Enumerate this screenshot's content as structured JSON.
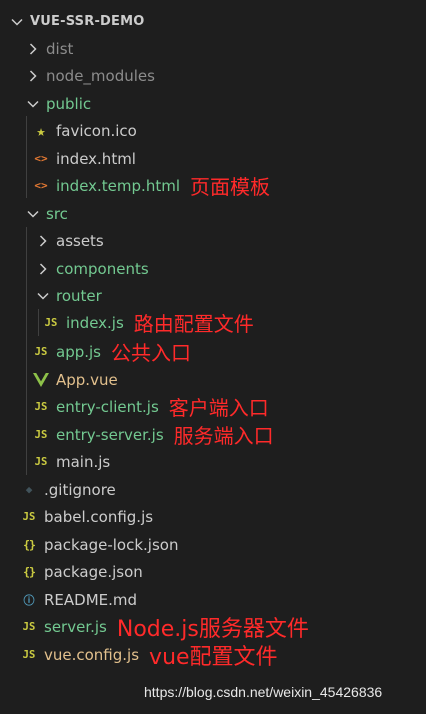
{
  "explorer": {
    "project_title": "VUE-SSR-DEMO",
    "items": [
      {
        "label": "dist",
        "icon": "chevron-right-icon",
        "annotation": ""
      },
      {
        "label": "node_modules",
        "icon": "chevron-right-icon",
        "annotation": ""
      },
      {
        "label": "public",
        "icon": "chevron-down-icon",
        "annotation": ""
      },
      {
        "label": "favicon.ico",
        "icon": "star-icon",
        "annotation": ""
      },
      {
        "label": "index.html",
        "icon": "html-icon",
        "annotation": ""
      },
      {
        "label": "index.temp.html",
        "icon": "html-icon",
        "annotation": "页面模板"
      },
      {
        "label": "src",
        "icon": "chevron-down-icon",
        "annotation": ""
      },
      {
        "label": "assets",
        "icon": "chevron-right-icon",
        "annotation": ""
      },
      {
        "label": "components",
        "icon": "chevron-right-icon",
        "annotation": ""
      },
      {
        "label": "router",
        "icon": "chevron-down-icon",
        "annotation": ""
      },
      {
        "label": "index.js",
        "icon": "js-icon",
        "annotation": "路由配置文件"
      },
      {
        "label": "app.js",
        "icon": "js-icon",
        "annotation": "公共入口"
      },
      {
        "label": "App.vue",
        "icon": "vue-icon",
        "annotation": ""
      },
      {
        "label": "entry-client.js",
        "icon": "js-icon",
        "annotation": "客户端入口"
      },
      {
        "label": "entry-server.js",
        "icon": "js-icon",
        "annotation": "服务端入口"
      },
      {
        "label": "main.js",
        "icon": "js-icon",
        "annotation": ""
      },
      {
        "label": ".gitignore",
        "icon": "git-icon",
        "annotation": ""
      },
      {
        "label": "babel.config.js",
        "icon": "js-icon",
        "annotation": ""
      },
      {
        "label": "package-lock.json",
        "icon": "json-icon",
        "annotation": ""
      },
      {
        "label": "package.json",
        "icon": "json-icon",
        "annotation": ""
      },
      {
        "label": "README.md",
        "icon": "info-icon",
        "annotation": ""
      },
      {
        "label": "server.js",
        "icon": "js-icon",
        "annotation": "Node.js服务器文件"
      },
      {
        "label": "vue.config.js",
        "icon": "js-icon",
        "annotation": "vue配置文件"
      }
    ]
  },
  "icons": {
    "js": "JS",
    "html": "<>",
    "json": "{}",
    "info": "ⓘ",
    "git": "◆",
    "star": "★",
    "vue": "V"
  },
  "watermark": "https://blog.csdn.net/weixin_45426836",
  "colors": {
    "background": "#1e1e1e",
    "text": "#cccccc",
    "ignored": "#8c8c8c",
    "modified": "#e2c08d",
    "untracked": "#73c991",
    "annotation": "#ff2a2a"
  }
}
